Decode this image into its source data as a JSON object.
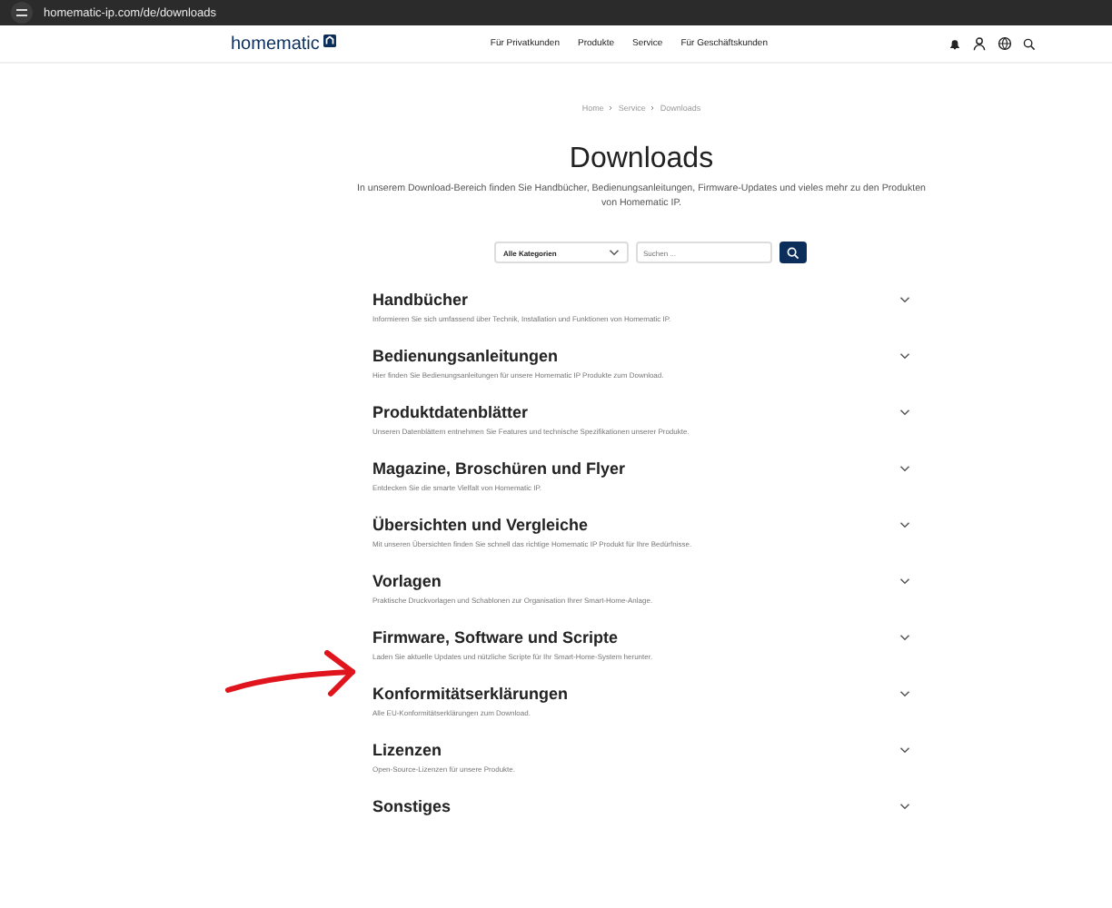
{
  "browser": {
    "url": "homematic-ip.com/de/downloads"
  },
  "header": {
    "logo": "homematic",
    "nav": [
      "Für Privatkunden",
      "Produkte",
      "Service",
      "Für Geschäftskunden"
    ]
  },
  "breadcrumb": [
    "Home",
    "Service",
    "Downloads"
  ],
  "title": "Downloads",
  "intro": "In unserem Download-Bereich finden Sie Handbücher, Bedienungsanleitungen, Firmware-Updates und vieles mehr zu den Produkten von Homematic IP.",
  "filter": {
    "category": "Alle Kategorien",
    "search_placeholder": "Suchen ..."
  },
  "categories": [
    {
      "title": "Handbücher",
      "description": "Informieren Sie sich umfassend über Technik, Installation und Funktionen von Homematic IP.",
      "expanded": false
    },
    {
      "title": "Bedienungsanleitungen",
      "description": "Hier finden Sie Bedienungsanleitungen für unsere Homematic IP Produkte zum Download.",
      "expanded": false
    },
    {
      "title": "Produktdatenblätter",
      "description": "Unseren Datenblättern entnehmen Sie Features und technische Spezifikationen unserer Produkte.",
      "expanded": false
    },
    {
      "title": "Magazine, Broschüren und Flyer",
      "description": "Entdecken Sie die smarte Vielfalt von Homematic IP.",
      "expanded": false
    },
    {
      "title": "Übersichten und Vergleiche",
      "description": "Mit unseren Übersichten finden Sie schnell das richtige Homematic IP Produkt für Ihre Bedürfnisse.",
      "expanded": false
    },
    {
      "title": "Vorlagen",
      "description": "Praktische Druckvorlagen und Schablonen zur Organisation Ihrer Smart-Home-Anlage.",
      "expanded": false
    },
    {
      "title": "Firmware, Software und Scripte",
      "description": "Laden Sie aktuelle Updates und nützliche Scripte für Ihr Smart-Home-System herunter.",
      "expanded": false
    },
    {
      "title": "Konformitätserklärungen",
      "description": "Alle EU-Konformitätserklärungen zum Download.",
      "expanded": false
    },
    {
      "title": "Lizenzen",
      "description": "Open-Source-Lizenzen für unsere Produkte.",
      "expanded": false
    },
    {
      "title": "Sonstiges",
      "expanded": false
    }
  ]
}
